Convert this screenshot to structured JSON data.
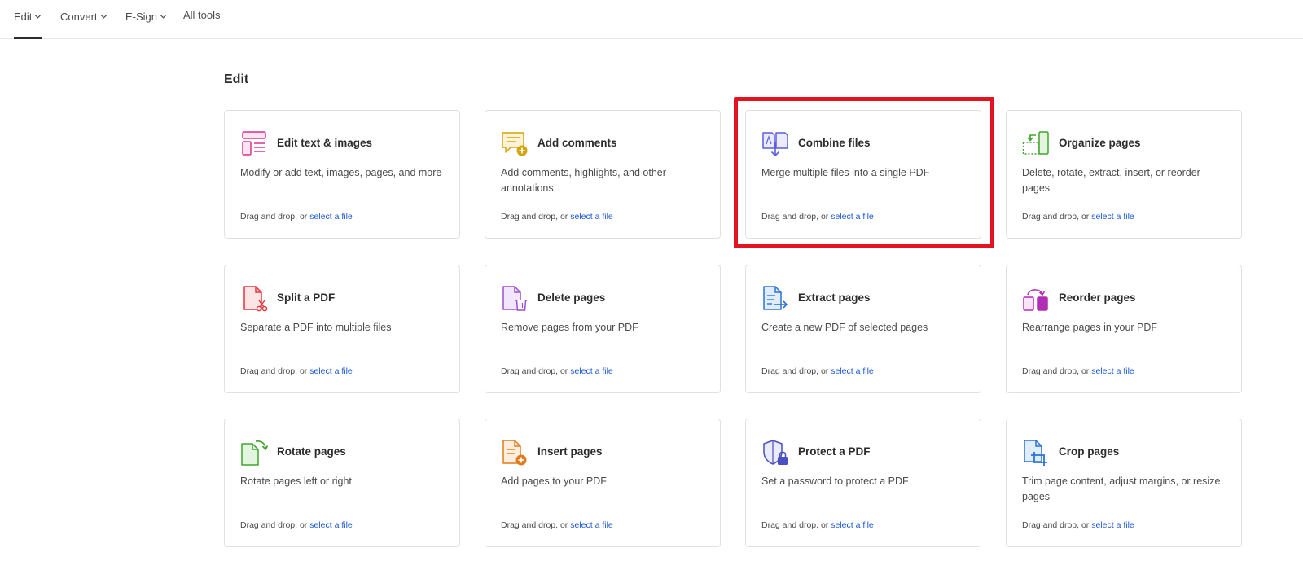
{
  "nav": {
    "items": [
      {
        "label": "Edit",
        "has_chevron": true,
        "active": true
      },
      {
        "label": "Convert",
        "has_chevron": true,
        "active": false
      },
      {
        "label": "E-Sign",
        "has_chevron": true,
        "active": false
      },
      {
        "label": "All tools",
        "has_chevron": false,
        "active": false
      }
    ]
  },
  "section": {
    "title": "Edit"
  },
  "drop_text": "Drag and drop, or ",
  "link_text": "select a file",
  "cards": [
    {
      "title": "Edit text & images",
      "desc": "Modify or add text, images, pages, and more",
      "icon": "edit-text-images-icon"
    },
    {
      "title": "Add comments",
      "desc": "Add comments, highlights, and other annotations",
      "icon": "add-comments-icon"
    },
    {
      "title": "Combine files",
      "desc": "Merge multiple files into a single PDF",
      "icon": "combine-files-icon"
    },
    {
      "title": "Organize pages",
      "desc": "Delete, rotate, extract, insert, or reorder pages",
      "icon": "organize-pages-icon"
    },
    {
      "title": "Split a PDF",
      "desc": "Separate a PDF into multiple files",
      "icon": "split-pdf-icon"
    },
    {
      "title": "Delete pages",
      "desc": "Remove pages from your PDF",
      "icon": "delete-pages-icon"
    },
    {
      "title": "Extract pages",
      "desc": "Create a new PDF of selected pages",
      "icon": "extract-pages-icon"
    },
    {
      "title": "Reorder pages",
      "desc": "Rearrange pages in your PDF",
      "icon": "reorder-pages-icon"
    },
    {
      "title": "Rotate pages",
      "desc": "Rotate pages left or right",
      "icon": "rotate-pages-icon"
    },
    {
      "title": "Insert pages",
      "desc": "Add pages to your PDF",
      "icon": "insert-pages-icon"
    },
    {
      "title": "Protect a PDF",
      "desc": "Set a password to protect a PDF",
      "icon": "protect-pdf-icon"
    },
    {
      "title": "Crop pages",
      "desc": "Trim page content, adjust margins, or resize pages",
      "icon": "crop-pages-icon"
    }
  ],
  "highlighted_card": "Combine files",
  "colors": {
    "link": "#1a57d6",
    "highlight": "#e3131f",
    "edit": "#d8338a",
    "comments": "#d4a20a",
    "combine": "#5c5ce0",
    "organize": "#3ea52b",
    "split": "#e0343b",
    "delete": "#9a4fd0",
    "extract": "#2a73d8",
    "reorder": "#b02fb5",
    "rotate": "#3ea52b",
    "insert": "#e07b1a",
    "protect": "#4a4fc2",
    "crop": "#2a73d8"
  }
}
